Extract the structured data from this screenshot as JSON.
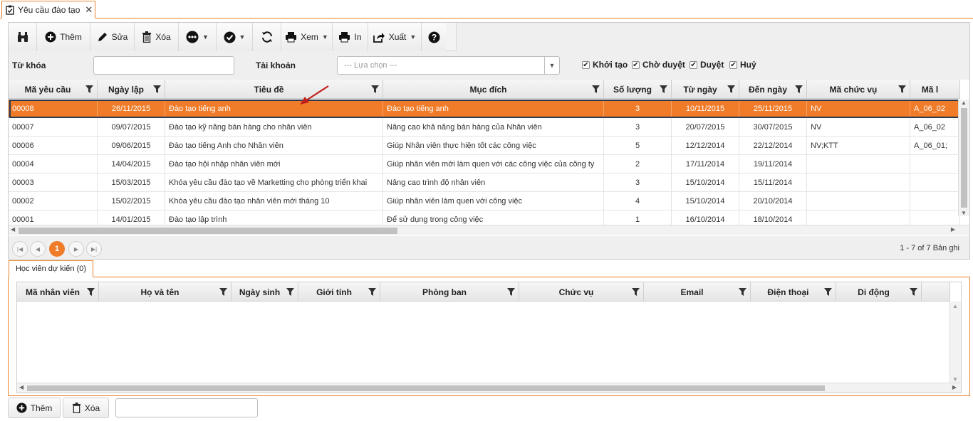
{
  "tab": {
    "title": "Yêu cầu đào tạo",
    "close": "✕"
  },
  "toolbar": {
    "search_icon": "binoculars-icon",
    "add_label": "Thêm",
    "edit_label": "Sửa",
    "delete_label": "Xóa",
    "more_icon": "more-icon",
    "approve_icon": "check-circle-icon",
    "refresh_icon": "refresh-icon",
    "view_label": "Xem",
    "print_label": "In",
    "export_label": "Xuất",
    "help_icon": "help-icon"
  },
  "filters": {
    "keyword_label": "Từ khóa",
    "keyword_value": "",
    "account_label": "Tài khoản",
    "account_placeholder": "--- Lựa chọn ---",
    "status": [
      {
        "label": "Khởi tạo",
        "checked": true
      },
      {
        "label": "Chờ duyệt",
        "checked": true
      },
      {
        "label": "Duyệt",
        "checked": true
      },
      {
        "label": "Huỷ",
        "checked": true
      }
    ]
  },
  "grid": {
    "columns": [
      "Mã yêu cầu",
      "Ngày lập",
      "Tiêu đề",
      "Mục đích",
      "Số lượng",
      "Từ ngày",
      "Đến ngày",
      "Mã chức vụ",
      "Mã l"
    ],
    "rows": [
      [
        "00008",
        "26/11/2015",
        "Đào tạo tiếng anh",
        "Đào tạo tiếng anh",
        "3",
        "10/11/2015",
        "25/11/2015",
        "NV",
        "A_06_02"
      ],
      [
        "00007",
        "09/07/2015",
        "Đào tạo kỹ năng bán hàng cho nhân viên",
        "Nâng cao khả năng bán hàng của Nhân viên",
        "3",
        "20/07/2015",
        "30/07/2015",
        "NV",
        "A_06_02"
      ],
      [
        "00006",
        "09/06/2015",
        "Đào tạo tiếng Anh cho Nhân viên",
        "Giúp Nhân viên thực hiện tốt các công việc",
        "5",
        "12/12/2014",
        "22/12/2014",
        "NV;KTT",
        "A_06_01;"
      ],
      [
        "00004",
        "14/04/2015",
        "Đào tạo hội nhập nhân viên mới",
        "Giúp nhân viên mới làm quen với các công việc của công ty",
        "2",
        "17/11/2014",
        "19/11/2014",
        "",
        ""
      ],
      [
        "00003",
        "15/03/2015",
        "Khóa yêu cầu đào tạo về Marketting cho phòng triển khai",
        "Nâng cao trình độ nhân viên",
        "3",
        "15/10/2014",
        "15/11/2014",
        "",
        ""
      ],
      [
        "00002",
        "15/02/2015",
        "Khóa yêu cầu đào tạo nhân viên mới tháng 10",
        "Giúp nhân viên làm quen với công việc",
        "4",
        "15/10/2014",
        "20/10/2014",
        "",
        ""
      ],
      [
        "00001",
        "14/01/2015",
        "Đào tạo lập trình",
        "Để sử dụng trong công việc",
        "1",
        "16/10/2014",
        "18/10/2014",
        "",
        ""
      ]
    ],
    "selected_index": 0
  },
  "pager": {
    "current_page": "1",
    "info": "1 - 7 of 7 Bản ghi"
  },
  "subtab": {
    "title": "Học viên dự kiến (0)"
  },
  "grid2": {
    "columns": [
      "Mã nhân viên",
      "Họ và tên",
      "Ngày sinh",
      "Giới tính",
      "Phòng ban",
      "Chức vụ",
      "Email",
      "Điện thoại",
      "Di động"
    ]
  },
  "bottom": {
    "add_label": "Thêm",
    "delete_label": "Xóa",
    "input_value": ""
  },
  "colors": {
    "accent": "#f07b28",
    "tab_border": "#e8832a",
    "selection_outline": "#2d3a4d"
  }
}
